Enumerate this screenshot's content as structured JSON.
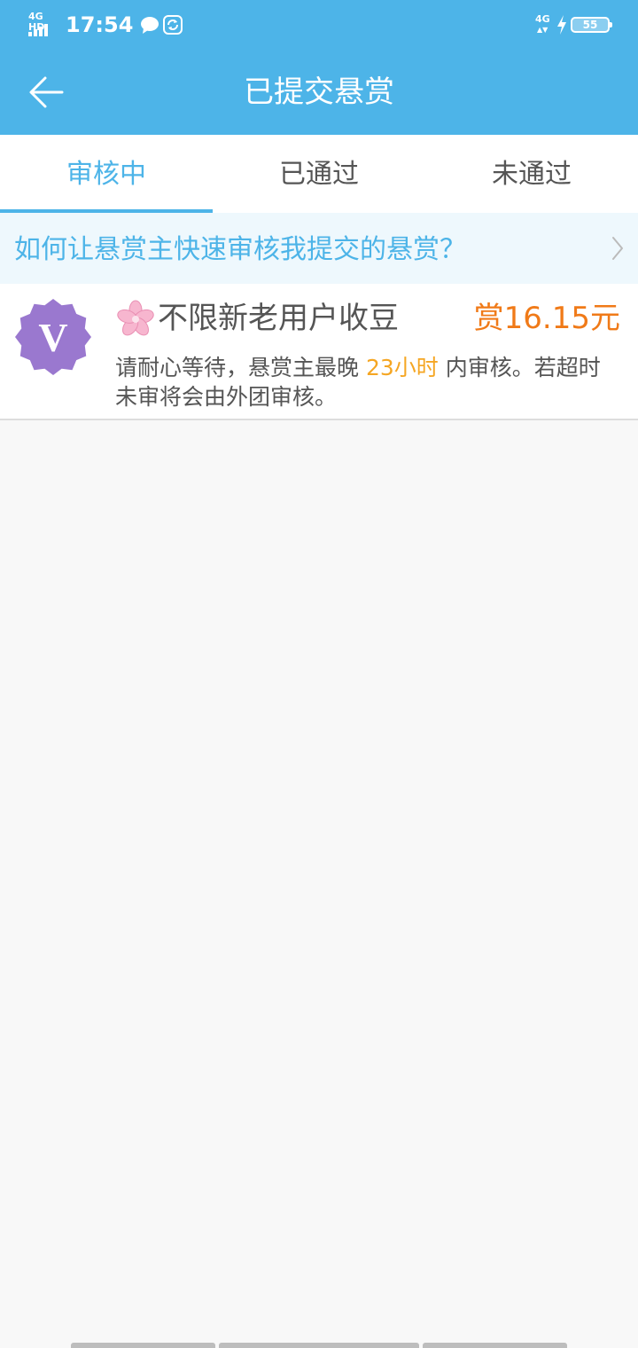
{
  "status_bar": {
    "network_left": "4G HD",
    "time": "17:54",
    "network_right": "4G",
    "battery": "55",
    "icons": [
      "signal-icon",
      "chat-bubble-icon",
      "sync-icon",
      "data-arrows-icon",
      "charging-icon",
      "battery-icon"
    ]
  },
  "header": {
    "title": "已提交悬赏",
    "back_icon": "arrow-left-icon"
  },
  "tabs": [
    {
      "label": "审核中",
      "active": true
    },
    {
      "label": "已通过",
      "active": false
    },
    {
      "label": "未通过",
      "active": false
    }
  ],
  "tip": {
    "text": "如何让悬赏主快速审核我提交的悬赏？",
    "icon": "chevron-right-icon"
  },
  "items": [
    {
      "avatar_letter": "V",
      "flower_icon": "cherry-blossom-icon",
      "title": "不限新老用户收豆",
      "reward": "赏16.15元",
      "desc_before": "请耐心等待，悬赏主最晚 ",
      "desc_highlight": "23小时",
      "desc_after": " 内审核。若超时未审将会由外团审核。"
    }
  ],
  "colors": {
    "primary": "#4db4e8",
    "reward": "#f07a18",
    "highlight": "#f5a623",
    "avatar": "#9a78cf",
    "text": "#555555",
    "background": "#f8f8f8"
  }
}
